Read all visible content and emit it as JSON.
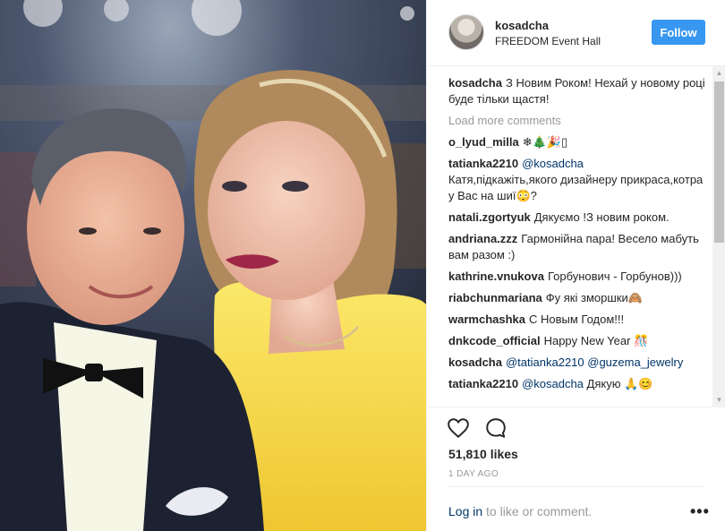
{
  "header": {
    "username": "kosadcha",
    "location": "FREEDOM Event Hall",
    "follow_label": "Follow"
  },
  "caption": {
    "user": "kosadcha",
    "text": "З Новим Роком! Нехай у новому році буде тільки щастя!"
  },
  "load_more_label": "Load more comments",
  "comments": [
    {
      "user": "o_lyud_milla",
      "mention": "",
      "text": "❄🎄🎉▯"
    },
    {
      "user": "tatianka2210",
      "mention": "@kosadcha",
      "text": "Катя,підкажіть,якого дизайнеру прикраса,котра у Вас на шиї😳?"
    },
    {
      "user": "natali.zgortyuk",
      "mention": "",
      "text": "Дякуємо !З новим роком."
    },
    {
      "user": "andriana.zzz",
      "mention": "",
      "text": "Гармонійна пара! Весело мабуть вам разом :)"
    },
    {
      "user": "kathrine.vnukova",
      "mention": "",
      "text": "Горбунович - Горбунов)))"
    },
    {
      "user": "riabchunmariana",
      "mention": "",
      "text": "Фу які зморшки🙈"
    },
    {
      "user": "warmchashka",
      "mention": "",
      "text": "С Новым Годом!!!"
    },
    {
      "user": "dnkcode_official",
      "mention": "",
      "text": "Happy New Year 🎊"
    },
    {
      "user": "kosadcha",
      "mention": "@tatianka2210 @guzema_jewelry",
      "text": ""
    },
    {
      "user": "tatianka2210",
      "mention": "@kosadcha",
      "text": "Дякую 🙏😊"
    }
  ],
  "likes": "51,810 likes",
  "time_ago": "1 DAY AGO",
  "login": {
    "link": "Log in",
    "rest": "to like or comment."
  },
  "icons": {
    "like": "heart-icon",
    "comment": "comment-bubble-icon",
    "more": "more-dots-icon"
  },
  "colors": {
    "accent": "#3897f0",
    "link": "#003569",
    "muted": "#999999",
    "dress": "#f5d63a"
  }
}
